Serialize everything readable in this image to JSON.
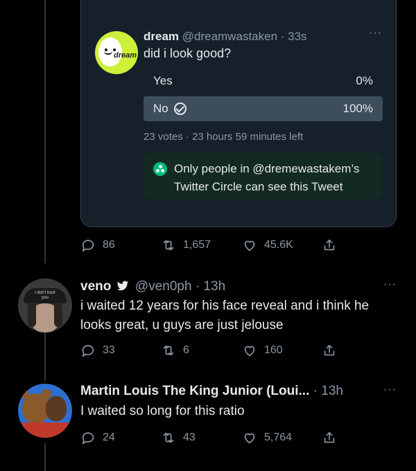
{
  "quoted": {
    "avatar_text": "dream",
    "name": "dream",
    "handle": "@dreamwastaken",
    "time": "33s",
    "text": "did i look good?",
    "poll": [
      {
        "label": "Yes",
        "pct": "0%",
        "winner": false
      },
      {
        "label": "No",
        "pct": "100%",
        "winner": true
      }
    ],
    "votes": "23 votes",
    "time_left": "23 hours 59 minutes left",
    "circle_notice": "Only people in @dremewastakem’s Twitter Circle can see this Tweet"
  },
  "main_actions": {
    "replies": "86",
    "retweets": "1,657",
    "likes": "45.6K"
  },
  "replies": [
    {
      "name": "veno",
      "handle": "@ven0ph",
      "time": "13h",
      "text": "i waited 12 years for his face reveal and i think he looks great, u guys are just jelouse",
      "avatar_caption": "i don't trust you",
      "replies": "33",
      "retweets": "6",
      "likes": "160"
    },
    {
      "name": "Martin Louis The King Junior (Loui...",
      "time": "13h",
      "text": "I waited so long for this ratio",
      "replies": "24",
      "retweets": "43",
      "likes": "5,764"
    }
  ],
  "colors": {
    "accent_green": "#00ba7c",
    "card_bg": "#15202b",
    "poll_fill": "#3d4d5c"
  }
}
